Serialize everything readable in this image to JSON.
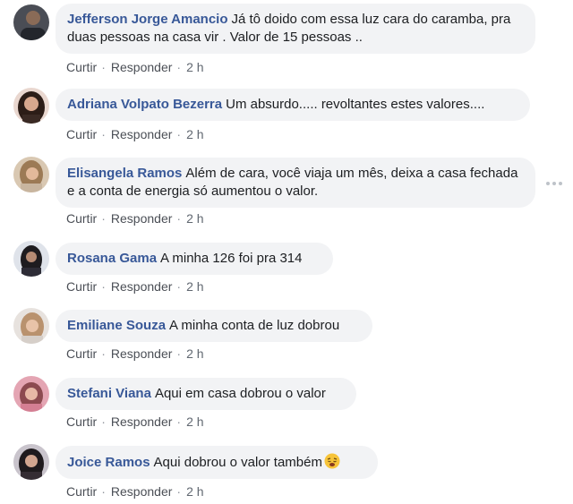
{
  "comments": [
    {
      "author": "Jefferson Jorge Amancio",
      "text": "Já tô doido com essa luz cara do caramba, pra duas pessoas na casa vir . Valor de 15 pessoas ..",
      "like": "Curtir",
      "reply": "Responder",
      "time": "2 h"
    },
    {
      "author": "Adriana Volpato Bezerra",
      "text": "Um absurdo..... revoltantes estes valores....",
      "like": "Curtir",
      "reply": "Responder",
      "time": "2 h"
    },
    {
      "author": "Elisangela Ramos",
      "text": "Além de cara, você viaja um mês, deixa a casa fechada e a conta de energia só aumentou o valor.",
      "like": "Curtir",
      "reply": "Responder",
      "time": "2 h"
    },
    {
      "author": "Rosana Gama",
      "text": "A minha 126 foi pra 314",
      "like": "Curtir",
      "reply": "Responder",
      "time": "2 h"
    },
    {
      "author": "Emiliane Souza",
      "text": "A minha conta de luz dobrou",
      "like": "Curtir",
      "reply": "Responder",
      "time": "2 h"
    },
    {
      "author": "Stefani Viana",
      "text": "Aqui em casa dobrou o valor",
      "like": "Curtir",
      "reply": "Responder",
      "time": "2 h"
    },
    {
      "author": "Joice Ramos",
      "text": "Aqui dobrou o valor também",
      "emoji": "weary-face-emoji",
      "like": "Curtir",
      "reply": "Responder",
      "time": "2 h"
    }
  ],
  "separator": "·",
  "colors": {
    "author": "#385898",
    "bubble": "#f2f3f5",
    "meta": "#606770"
  }
}
